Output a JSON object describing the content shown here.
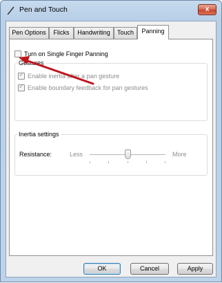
{
  "window": {
    "title": "Pen and Touch",
    "close_label": "x"
  },
  "tabs": [
    "Pen Options",
    "Flicks",
    "Handwriting",
    "Touch",
    "Panning"
  ],
  "active_tab": "Panning",
  "panning": {
    "single_finger_label": "Turn on Single Finger Panning",
    "single_finger_checked": false,
    "gestures_title": "Gestures",
    "inertia_label": "Enable inertia after a pan gesture",
    "inertia_checked": true,
    "boundary_label": "Enable boundary feedback for pan gestures",
    "boundary_checked": true,
    "inertia_settings_title": "Inertia settings",
    "resistance_label": "Resistance:",
    "less_label": "Less",
    "more_label": "More",
    "resistance_value_fraction": 0.5
  },
  "buttons": {
    "ok": "OK",
    "cancel": "Cancel",
    "apply": "Apply"
  },
  "colors": {
    "annotation_arrow": "#c0141b"
  }
}
